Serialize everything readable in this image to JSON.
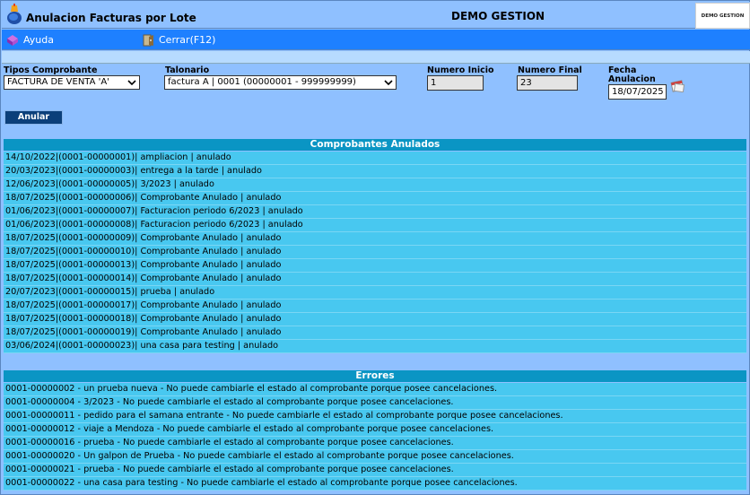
{
  "header": {
    "app_title": "Anulacion Facturas por Lote",
    "company": "DEMO GESTION",
    "logo_text": "DEMO GESTION"
  },
  "menu": {
    "help_label": "Ayuda",
    "close_label": "Cerrar(F12)"
  },
  "filters": {
    "tipos_label": "Tipos Comprobante",
    "tipos_value": "FACTURA DE VENTA 'A'",
    "talonario_label": "Talonario",
    "talonario_value": "factura A | 0001 (00000001 - 999999999)",
    "numero_inicio_label": "Numero Inicio",
    "numero_inicio_value": "1",
    "numero_final_label": "Numero Final",
    "numero_final_value": "23",
    "fecha_label_1": "Fecha",
    "fecha_label_2": "Anulacion",
    "fecha_value": "18/07/2025"
  },
  "actions": {
    "anular_label": "Anular"
  },
  "anulados": {
    "title": "Comprobantes Anulados",
    "rows": [
      "14/10/2022|(0001-00000001)| ampliacion | anulado",
      "20/03/2023|(0001-00000003)| entrega a la tarde | anulado",
      "12/06/2023|(0001-00000005)| 3/2023 | anulado",
      "18/07/2025|(0001-00000006)| Comprobante Anulado | anulado",
      "01/06/2023|(0001-00000007)| Facturacion periodo 6/2023 | anulado",
      "01/06/2023|(0001-00000008)| Facturacion periodo 6/2023 | anulado",
      "18/07/2025|(0001-00000009)| Comprobante Anulado | anulado",
      "18/07/2025|(0001-00000010)| Comprobante Anulado | anulado",
      "18/07/2025|(0001-00000013)| Comprobante Anulado | anulado",
      "18/07/2025|(0001-00000014)| Comprobante Anulado | anulado",
      "20/07/2023|(0001-00000015)| prueba | anulado",
      "18/07/2025|(0001-00000017)| Comprobante Anulado | anulado",
      "18/07/2025|(0001-00000018)| Comprobante Anulado | anulado",
      "18/07/2025|(0001-00000019)| Comprobante Anulado | anulado",
      "03/06/2024|(0001-00000023)| una casa para testing | anulado"
    ]
  },
  "errores": {
    "title": "Errores",
    "rows": [
      "0001-00000002 - un prueba nueva - No puede cambiarle el estado al comprobante porque posee cancelaciones.",
      "0001-00000004 - 3/2023 - No puede cambiarle el estado al comprobante porque posee cancelaciones.",
      "0001-00000011 - pedido para el samana entrante - No puede cambiarle el estado al comprobante porque posee cancelaciones.",
      "0001-00000012 - viaje a Mendoza - No puede cambiarle el estado al comprobante porque posee cancelaciones.",
      "0001-00000016 - prueba - No puede cambiarle el estado al comprobante porque posee cancelaciones.",
      "0001-00000020 - Un galpon de Prueba - No puede cambiarle el estado al comprobante porque posee cancelaciones.",
      "0001-00000021 - prueba - No puede cambiarle el estado al comprobante porque posee cancelaciones.",
      "0001-00000022 - una casa para testing - No puede cambiarle el estado al comprobante porque posee cancelaciones."
    ]
  }
}
